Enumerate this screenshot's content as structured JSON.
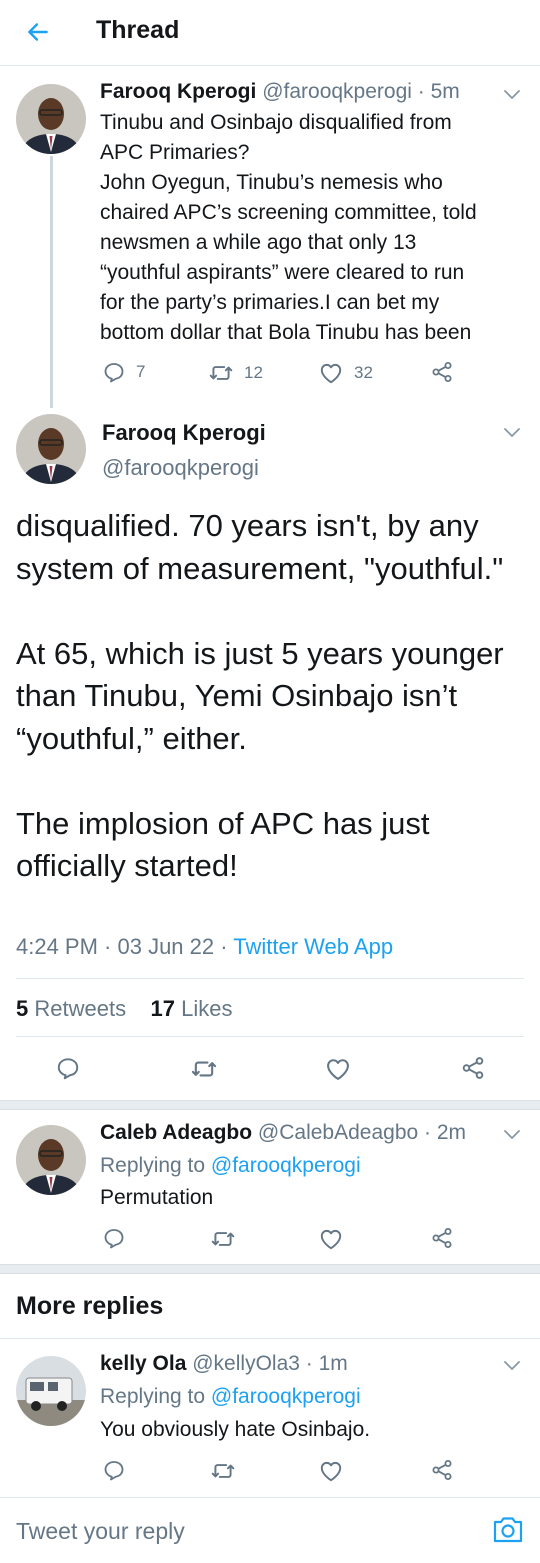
{
  "header": {
    "title": "Thread"
  },
  "tweets": [
    {
      "name": "Farooq Kperogi",
      "handle": "@farooqkperogi",
      "time": "5m",
      "lines": [
        "Tinubu and Osinbajo disqualified from",
        "APC Primaries?",
        "John Oyegun, Tinubu’s nemesis who",
        "chaired APC’s screening committee, told",
        "newsmen a while ago that only 13",
        "“youthful aspirants” were cleared to run",
        "for the party’s primaries.I can bet my",
        "bottom dollar that Bola Tinubu has been"
      ],
      "replies": "7",
      "retweets": "12",
      "likes": "32"
    }
  ],
  "focused": {
    "name": "Farooq Kperogi",
    "handle": "@farooqkperogi",
    "paragraphs": [
      "disqualified. 70 years isn't, by any system of measurement, \"youthful.\"",
      "At 65, which is just 5 years younger than Tinubu, Yemi Osinbajo isn’t “youthful,” either.",
      "The implosion of APC has just officially started!"
    ],
    "time": "4:24 PM · 03 Jun 22 · ",
    "source": "Twitter Web App",
    "retweet_count": "5",
    "retweet_label": "Retweets",
    "like_count": "17",
    "like_label": "Likes"
  },
  "replies": [
    {
      "name": "Caleb Adeagbo",
      "handle": "@CalebAdeagbo",
      "time": "2m",
      "replying_prefix": "Replying to ",
      "replying_to": "@farooqkperogi",
      "text": "Permutation"
    },
    {
      "name": "kelly Ola",
      "handle": "@kellyOla3",
      "time": "1m",
      "replying_prefix": "Replying to ",
      "replying_to": "@farooqkperogi",
      "text": "You obviously hate Osinbajo."
    }
  ],
  "more_replies": "More replies",
  "composer": {
    "placeholder": "Tweet your reply"
  },
  "colors": {
    "accent": "#1da1f2",
    "muted": "#657786",
    "border": "#e1e8ed",
    "separator": "#e6ecf0"
  },
  "icons": [
    "back-arrow-icon",
    "chevron-down-icon",
    "reply-icon",
    "retweet-icon",
    "like-icon",
    "share-icon",
    "camera-icon"
  ]
}
